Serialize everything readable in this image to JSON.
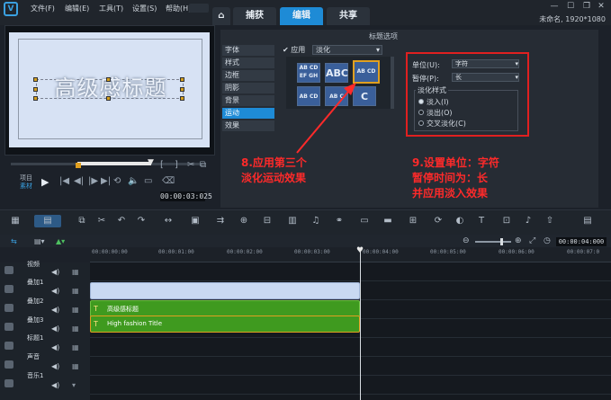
{
  "menu": [
    "文件(F)",
    "编辑(E)",
    "工具(T)",
    "设置(S)",
    "帮助(H)"
  ],
  "tabs": {
    "capture": "捕获",
    "edit": "编辑",
    "share": "共享"
  },
  "project_info": "未命名, 1920*1080",
  "preview": {
    "title_text": "高级感标题",
    "mode_project": "项目",
    "mode_clip": "素材",
    "timecode": "00:00:03:025"
  },
  "options_panel": {
    "title": "标题选项",
    "side_tabs": [
      "字体",
      "样式",
      "边框",
      "阴影",
      "背景",
      "运动",
      "效果"
    ],
    "active_side_tab": "运动",
    "apply_label": "应用",
    "effect_select": "淡化",
    "thumbs": [
      "AB CD EF GH",
      "ABC",
      "AB CD",
      "AB CD",
      "AB C",
      "C"
    ],
    "unit_label": "单位(U):",
    "unit_value": "字符",
    "pause_label": "暂停(P):",
    "pause_value": "长",
    "fade_style_label": "淡化样式",
    "fade_options": [
      "淡入(I)",
      "淡出(O)",
      "交叉淡化(C)"
    ],
    "fade_selected": 0
  },
  "annotations": {
    "left": [
      "8.应用第三个",
      "淡化运动效果"
    ],
    "right": [
      "9.设置单位：字符",
      "暂停时间为：长",
      "并应用淡入效果"
    ]
  },
  "timeline": {
    "header_timecode": "00:00:04:000",
    "ruler": [
      "00:00:00:00",
      "00:00:01:00",
      "00:00:02:00",
      "00:00:03:00",
      "00:00:04:00",
      "00:00:05:00",
      "00:00:06:00",
      "00:00:07:0"
    ],
    "tracks": [
      "视频",
      "叠加1",
      "叠加2",
      "叠加3",
      "标题1",
      "声音",
      "音乐1"
    ],
    "clips": {
      "overlay2": "高级感标题",
      "overlay3": "High fashion Title"
    }
  },
  "colors": {
    "accent": "#1e8bd6",
    "annotation": "#ff2a2a",
    "clip_green": "#3f9a1f",
    "clip_blue": "#c9d9f2"
  }
}
